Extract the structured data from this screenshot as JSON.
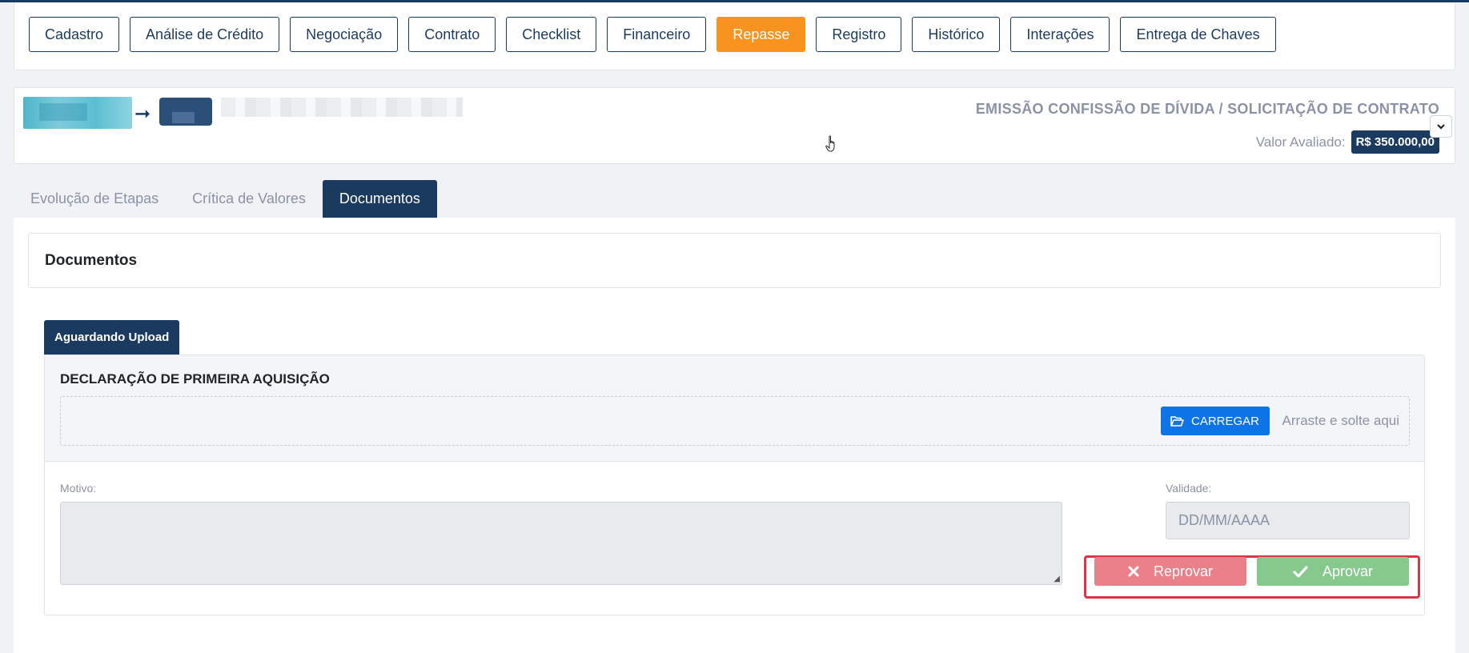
{
  "stages": [
    {
      "label": "Cadastro",
      "active": false
    },
    {
      "label": "Análise de Crédito",
      "active": false
    },
    {
      "label": "Negociação",
      "active": false
    },
    {
      "label": "Contrato",
      "active": false
    },
    {
      "label": "Checklist",
      "active": false
    },
    {
      "label": "Financeiro",
      "active": false
    },
    {
      "label": "Repasse",
      "active": true
    },
    {
      "label": "Registro",
      "active": false
    },
    {
      "label": "Histórico",
      "active": false
    },
    {
      "label": "Interações",
      "active": false
    },
    {
      "label": "Entrega de Chaves",
      "active": false
    }
  ],
  "header": {
    "title": "EMISSÃO CONFISSÃO DE DÍVIDA / SOLICITAÇÃO DE CONTRATO",
    "value_label": "Valor Avaliado:",
    "value": "R$ 350.000,00"
  },
  "tabs": [
    {
      "label": "Evolução de Etapas",
      "active": false
    },
    {
      "label": "Crítica de Valores",
      "active": false
    },
    {
      "label": "Documentos",
      "active": true
    }
  ],
  "documents": {
    "section_title": "Documentos",
    "status_tab": "Aguardando Upload",
    "document_name": "DECLARAÇÃO DE PRIMEIRA AQUISIÇÃO",
    "upload_label": "CARREGAR",
    "drop_hint": "Arraste e solte aqui",
    "motivo_label": "Motivo:",
    "validade_label": "Validade:",
    "validade_placeholder": "DD/MM/AAAA",
    "reject_label": "Reprovar",
    "approve_label": "Aprovar"
  },
  "colors": {
    "primary": "#1b3a5f",
    "active_stage": "#f7931e",
    "upload": "#0d74e7",
    "reject": "#e9808a",
    "approve": "#85c98d",
    "highlight": "#dc3545"
  }
}
